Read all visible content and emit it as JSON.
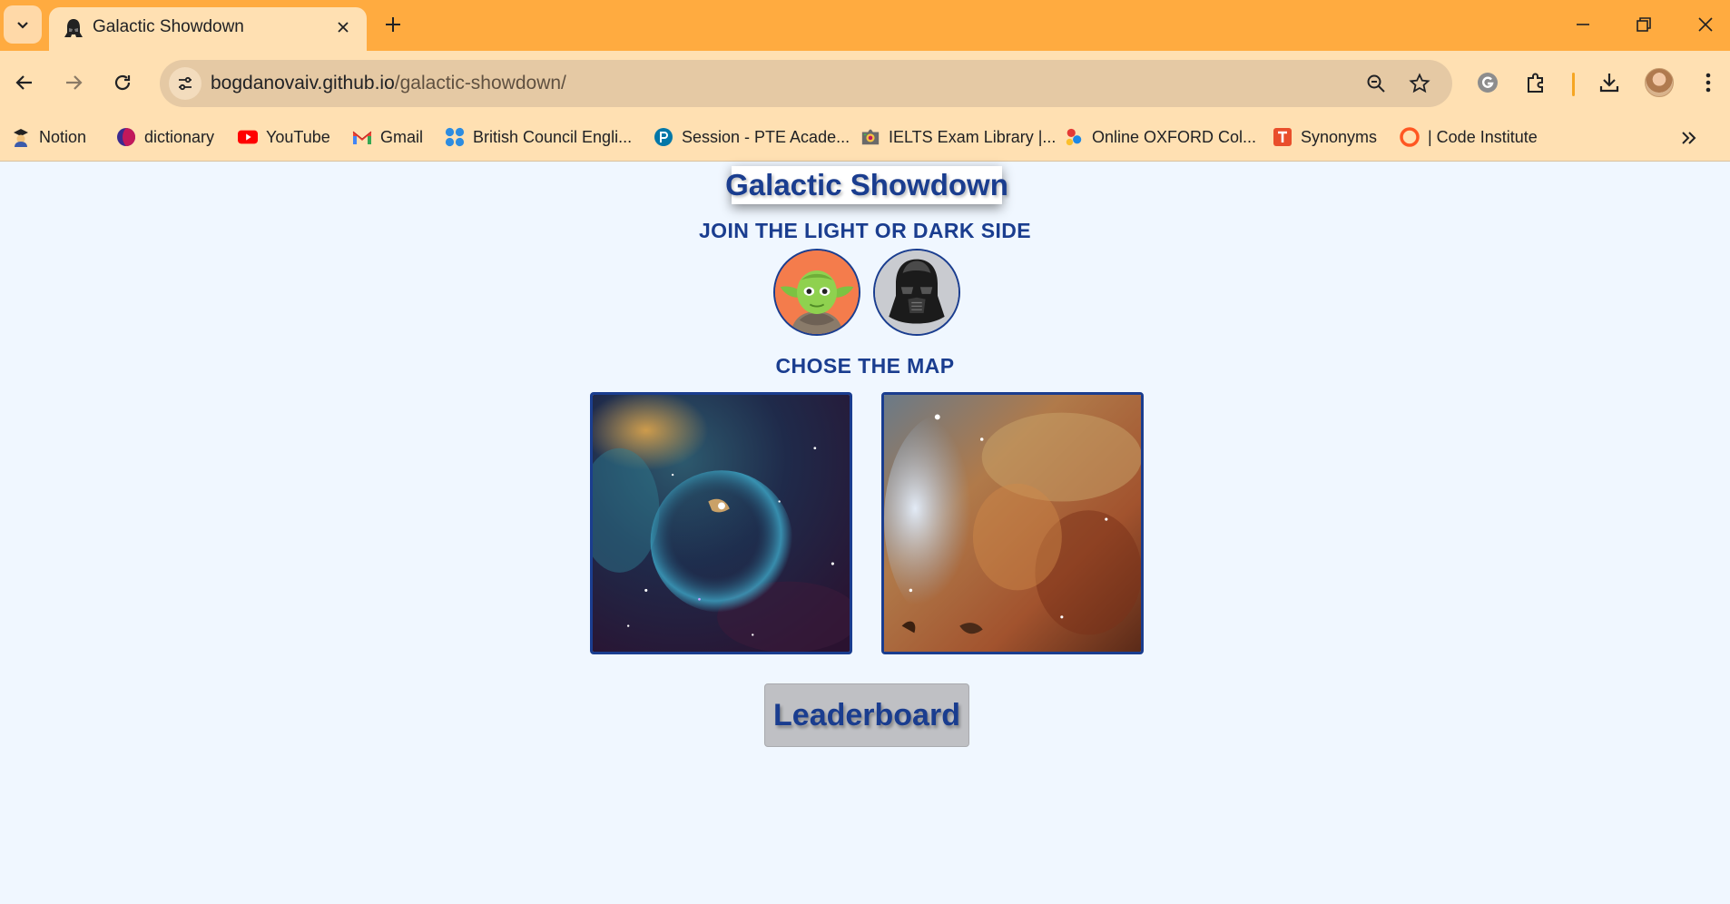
{
  "browser": {
    "tab": {
      "title": "Galactic Showdown",
      "favicon": "darth-vader-helmet-icon"
    },
    "address": {
      "domain": "bogdanovaiv.github.io",
      "path": "/galactic-showdown/"
    },
    "bookmarks": [
      {
        "label": "Notion",
        "icon": "notion-graduate-icon"
      },
      {
        "label": "dictionary",
        "icon": "dictionary-icon"
      },
      {
        "label": "YouTube",
        "icon": "youtube-icon"
      },
      {
        "label": "Gmail",
        "icon": "gmail-icon"
      },
      {
        "label": "British Council Engli...",
        "icon": "british-council-icon"
      },
      {
        "label": "Session - PTE Acade...",
        "icon": "pte-icon"
      },
      {
        "label": "IELTS Exam Library |...",
        "icon": "ielts-icon"
      },
      {
        "label": "Online OXFORD Col...",
        "icon": "oxford-icon"
      },
      {
        "label": "Synonyms",
        "icon": "synonyms-icon"
      },
      {
        "label": "| Code Institute",
        "icon": "code-institute-icon"
      }
    ]
  },
  "page": {
    "title": "Galactic Showdown",
    "side_prompt": "JOIN THE LIGHT OR DARK SIDE",
    "sides": [
      {
        "name": "light side",
        "icon": "yoda-icon"
      },
      {
        "name": "dark side",
        "icon": "darth-vader-icon"
      }
    ],
    "map_prompt": "CHOSE THE MAP",
    "maps": [
      {
        "name": "bubble nebula",
        "icon": "bubble-nebula-image"
      },
      {
        "name": "keyhole nebula",
        "icon": "keyhole-nebula-image"
      }
    ],
    "leaderboard_label": "Leaderboard"
  },
  "colors": {
    "tabbar": "#ffab40",
    "chrome": "#ffe0b2",
    "page_background": "#f0f7ff",
    "heading_blue": "#1a3d8f",
    "light_side_bg": "#f47c4c",
    "dark_side_bg": "#c9cbd0",
    "button_gray": "#bfc0c4"
  }
}
